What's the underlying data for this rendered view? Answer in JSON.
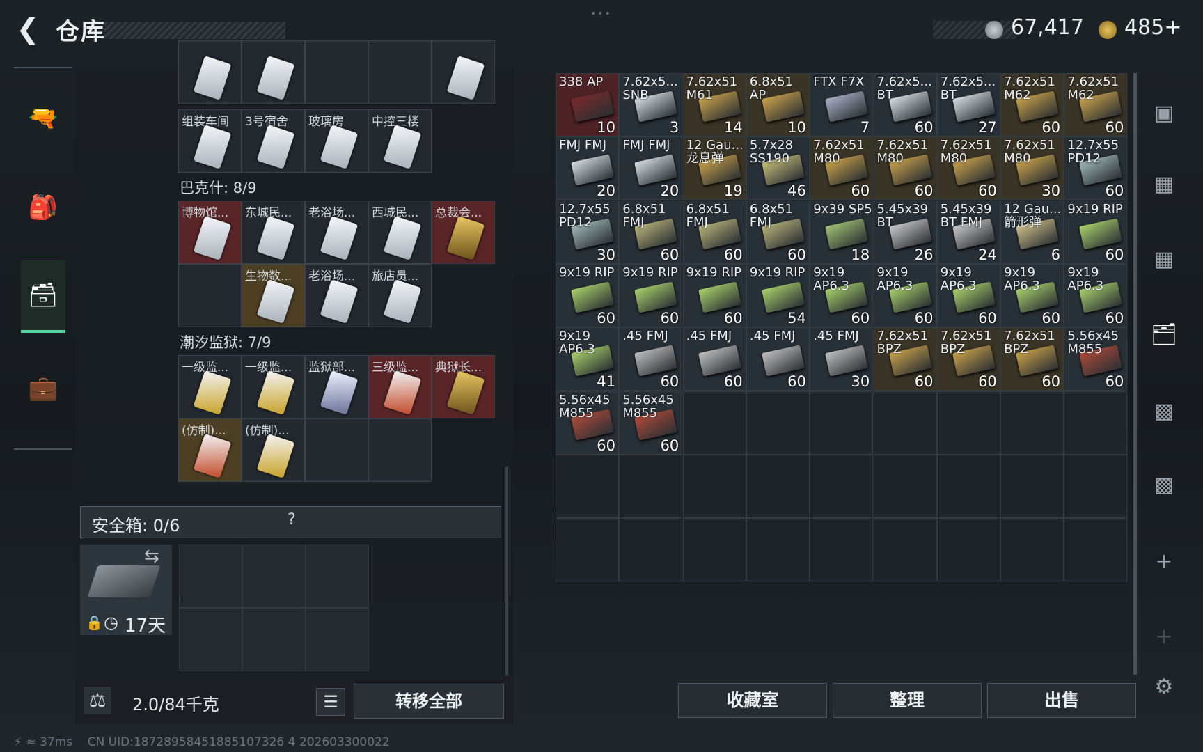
{
  "header": {
    "title": "仓库",
    "currency1": "67,417",
    "currency2": "485+"
  },
  "keys": {
    "top_row": [
      "",
      "",
      "",
      "",
      ""
    ],
    "row2": [
      "组装车间",
      "3号宿舍",
      "玻璃房",
      "中控三楼"
    ],
    "section1": "巴克什: 8/9",
    "row3": [
      "博物馆...",
      "东城民...",
      "老浴场...",
      "西城民...",
      "总裁会..."
    ],
    "row4": [
      "",
      "生物数...",
      "老浴场...",
      "旅店员..."
    ],
    "section2": "潮汐监狱: 7/9",
    "row5": [
      "一级监...",
      "一级监...",
      "监狱部...",
      "三级监...",
      "典狱长..."
    ],
    "row6": [
      "(仿制)...",
      "(仿制)..."
    ]
  },
  "safe": {
    "label": "安全箱: 0/6",
    "help": "?",
    "days": "17天"
  },
  "weight": {
    "value": "2.0/84千克",
    "transfer_label": "转移全部",
    "list_icon": "☰"
  },
  "stash": {
    "rows": [
      [
        [
          "338 AP",
          "10",
          "#7a2a2a"
        ],
        [
          "7.62x5... SNB",
          "3",
          "#d8dde2"
        ],
        [
          "7.62x51 M61",
          "14",
          "#c9a24a"
        ],
        [
          "6.8x51 AP",
          "10",
          "#c9a24a"
        ],
        [
          "FTX F7X",
          "7",
          "#aab0c6"
        ],
        [
          "7.62x5... BT",
          "60",
          "#d8dde2"
        ],
        [
          "7.62x5... BT",
          "27",
          "#d8dde2"
        ],
        [
          "7.62x51 M62",
          "60",
          "#c9a24a"
        ],
        [
          "7.62x51 M62",
          "60",
          "#c9a24a"
        ]
      ],
      [
        [
          "FMJ FMJ",
          "20",
          "#d8dde2"
        ],
        [
          "FMJ FMJ",
          "20",
          "#d8dde2"
        ],
        [
          "12 Gau... 龙息弹",
          "19",
          "#c9a24a"
        ],
        [
          "5.7x28 SS190",
          "46",
          "#c8c07a"
        ],
        [
          "7.62x51 M80",
          "60",
          "#c9a24a"
        ],
        [
          "7.62x51 M80",
          "60",
          "#c9a24a"
        ],
        [
          "7.62x51 M80",
          "60",
          "#c9a24a"
        ],
        [
          "7.62x51 M80",
          "30",
          "#c9a24a"
        ],
        [
          "12.7x55 PD12",
          "60",
          "#9fb7b5"
        ]
      ],
      [
        [
          "12.7x55 PD12",
          "30",
          "#9fb7b5"
        ],
        [
          "6.8x51 FMJ",
          "60",
          "#b8b27a"
        ],
        [
          "6.8x51 FMJ",
          "60",
          "#b8b27a"
        ],
        [
          "6.8x51 FMJ",
          "60",
          "#b8b27a"
        ],
        [
          "9x39 SP5",
          "18",
          "#a2c273"
        ],
        [
          "5.45x39 BT",
          "26",
          "#c9c9c9"
        ],
        [
          "5.45x39 BT FMJ",
          "24",
          "#c9c9c9"
        ],
        [
          "12 Gau... 箭形弹",
          "6",
          "#d0c08a"
        ],
        [
          "9x19 RIP",
          "60",
          "#a8d06a"
        ]
      ],
      [
        [
          "9x19 RIP",
          "60",
          "#a8d06a"
        ],
        [
          "9x19 RIP",
          "60",
          "#a8d06a"
        ],
        [
          "9x19 RIP",
          "60",
          "#a8d06a"
        ],
        [
          "9x19 RIP",
          "54",
          "#a8d06a"
        ],
        [
          "9x19 AP6.3",
          "60",
          "#a8d06a"
        ],
        [
          "9x19 AP6.3",
          "60",
          "#a8d06a"
        ],
        [
          "9x19 AP6.3",
          "60",
          "#a8d06a"
        ],
        [
          "9x19 AP6.3",
          "60",
          "#a8d06a"
        ],
        [
          "9x19 AP6.3",
          "60",
          "#a8d06a"
        ]
      ],
      [
        [
          "9x19 AP6.3",
          "41",
          "#a8d06a"
        ],
        [
          ".45 FMJ",
          "60",
          "#bfbfbf"
        ],
        [
          ".45 FMJ",
          "60",
          "#bfbfbf"
        ],
        [
          ".45 FMJ",
          "60",
          "#bfbfbf"
        ],
        [
          ".45 FMJ",
          "30",
          "#bfbfbf"
        ],
        [
          "7.62x51 BPZ",
          "60",
          "#c9a24a"
        ],
        [
          "7.62x51 BPZ",
          "60",
          "#c9a24a"
        ],
        [
          "7.62x51 BPZ",
          "60",
          "#c9a24a"
        ],
        [
          "5.56x45 M855",
          "60",
          "#b04a3a"
        ]
      ],
      [
        [
          "5.56x45 M855",
          "60",
          "#b04a3a"
        ],
        [
          "5.56x45 M855",
          "60",
          "#b04a3a"
        ]
      ]
    ]
  },
  "buttons": {
    "collection": "收藏室",
    "sort": "整理",
    "sell": "出售"
  },
  "status": {
    "ping": "37ms",
    "uid": "CN UID:18728958451885107326 4 202603300022"
  }
}
